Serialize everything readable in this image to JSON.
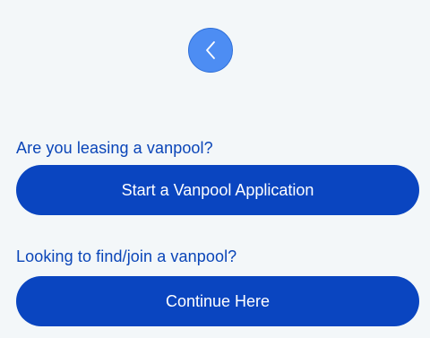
{
  "nav": {
    "back_icon": "chevron-left-icon"
  },
  "lease_section": {
    "prompt": "Are you leasing a vanpool?",
    "button_label": "Start a Vanpool Application"
  },
  "find_section": {
    "prompt": "Looking to find/join a vanpool?",
    "button_label": "Continue Here"
  },
  "colors": {
    "background": "#f3f7f9",
    "primary": "#0a45c0",
    "back_button": "#4d8df3",
    "prompt_text": "#0a45b8"
  }
}
